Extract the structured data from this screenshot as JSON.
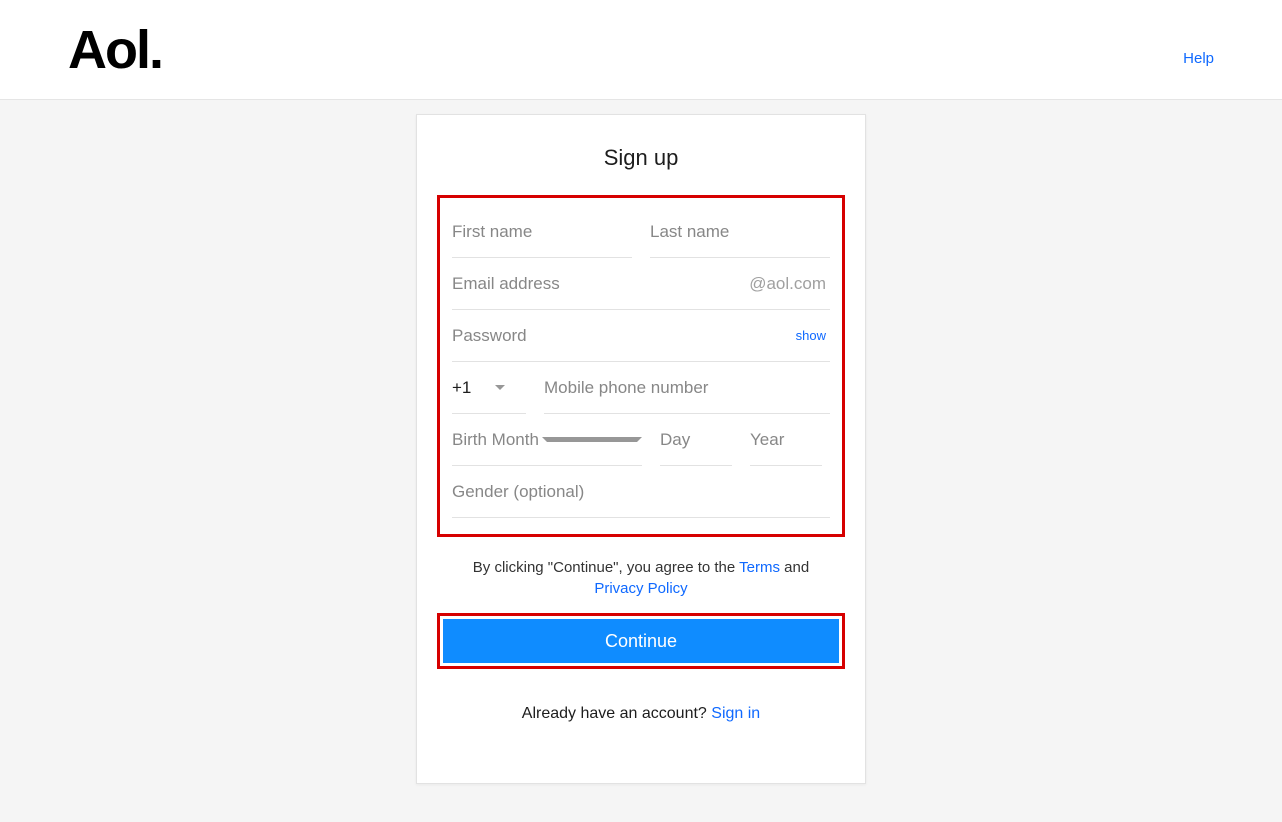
{
  "header": {
    "logo": "Aol.",
    "help": "Help"
  },
  "form": {
    "title": "Sign up",
    "first_name_ph": "First name",
    "last_name_ph": "Last name",
    "email_ph": "Email address",
    "email_suffix": "@aol.com",
    "password_ph": "Password",
    "show_label": "show",
    "country_code": "+1",
    "phone_ph": "Mobile phone number",
    "birth_month_ph": "Birth Month",
    "day_ph": "Day",
    "year_ph": "Year",
    "gender_ph": "Gender (optional)"
  },
  "legal": {
    "prefix": "By clicking \"Continue\", you agree to the ",
    "terms": "Terms",
    "and": " and ",
    "privacy": "Privacy Policy"
  },
  "button": {
    "continue": "Continue"
  },
  "footer": {
    "already_text": "Already have an account? ",
    "signin": "Sign in"
  }
}
